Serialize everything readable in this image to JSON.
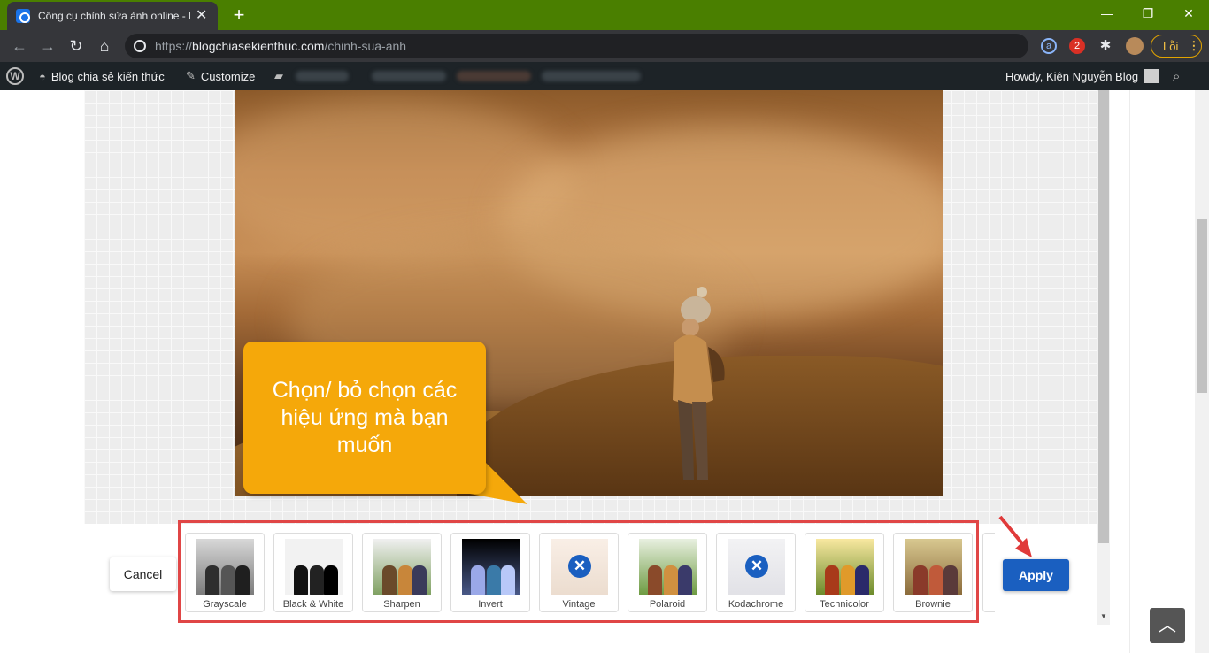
{
  "browser": {
    "tab_title": "Công cụ chỉnh sửa ảnh online - E",
    "url_scheme": "https://",
    "url_host": "blogchiasekienthuc.com",
    "url_path": "/chinh-sua-anh",
    "profile_label": "Lỗi",
    "extension_badge": "2"
  },
  "wp_admin_bar": {
    "site_name": "Blog chia sẻ kiến thức",
    "customize": "Customize",
    "howdy": "Howdy, Kiên Nguyễn Blog"
  },
  "editor": {
    "callout_text": "Chọn/ bỏ chọn các hiệu ứng mà bạn muốn",
    "cancel_label": "Cancel",
    "apply_label": "Apply",
    "filters": [
      {
        "label": "Grayscale",
        "disabled": false,
        "tint": "#9a9a9a"
      },
      {
        "label": "Black & White",
        "disabled": false,
        "tint": "#e6e6e6"
      },
      {
        "label": "Sharpen",
        "disabled": false,
        "tint": "#8fb07a"
      },
      {
        "label": "Invert",
        "disabled": false,
        "tint": "#2a2f5a"
      },
      {
        "label": "Vintage",
        "disabled": true,
        "tint": "#f2e4d8"
      },
      {
        "label": "Polaroid",
        "disabled": false,
        "tint": "#c9d6a8"
      },
      {
        "label": "Kodachrome",
        "disabled": true,
        "tint": "#e6e6ea"
      },
      {
        "label": "Technicolor",
        "disabled": false,
        "tint": "#e2c070"
      },
      {
        "label": "Brownie",
        "disabled": false,
        "tint": "#c8b07a"
      }
    ]
  },
  "colors": {
    "callout": "#f5a80a",
    "apply": "#1a5fc0",
    "highlight_border": "#e04646",
    "titlebar": "#4a7f00"
  },
  "icons": [
    "back-arrow-icon",
    "forward-arrow-icon",
    "reload-icon",
    "home-icon",
    "globe-icon",
    "puzzle-icon",
    "wordpress-icon",
    "dashboard-icon",
    "brush-icon",
    "comment-icon",
    "search-icon",
    "chevron-up-icon",
    "close-circle-icon"
  ]
}
